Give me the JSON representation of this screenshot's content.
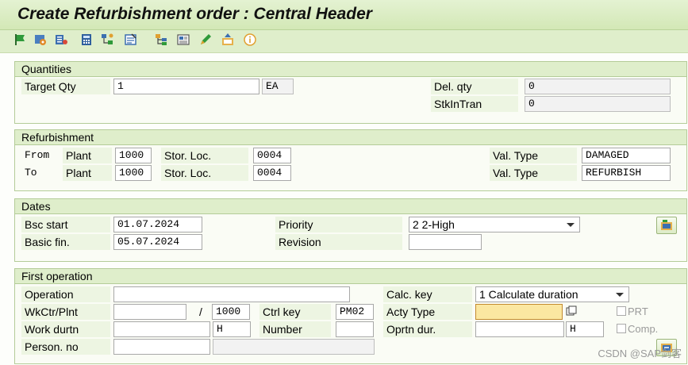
{
  "window": {
    "title": "Create Refurbishment order : Central Header"
  },
  "toolbar": {
    "icons": [
      "flag-icon",
      "settings-icon",
      "list-icon",
      "calculator-icon",
      "tree-icon",
      "task-list-icon",
      "hierarchy-icon",
      "document-icon",
      "edit-pen-icon",
      "upload-icon",
      "info-icon"
    ]
  },
  "quantities": {
    "title": "Quantities",
    "target_qty_label": "Target Qty",
    "target_qty_value": "1",
    "unit": "EA",
    "del_qty_label": "Del. qty",
    "del_qty_value": "0",
    "stk_in_tran_label": "StkInTran",
    "stk_in_tran_value": "0"
  },
  "refurbishment": {
    "title": "Refurbishment",
    "from_label": "From",
    "to_label": "To",
    "plant_label": "Plant",
    "stor_loc_label": "Stor. Loc.",
    "val_type_label": "Val. Type",
    "from_plant": "1000",
    "from_stor_loc": "0004",
    "from_val_type": "DAMAGED",
    "to_plant": "1000",
    "to_stor_loc": "0004",
    "to_val_type": "REFURBISH"
  },
  "dates": {
    "title": "Dates",
    "bsc_start_label": "Bsc start",
    "bsc_start_value": "01.07.2024",
    "basic_fin_label": "Basic fin.",
    "basic_fin_value": "05.07.2024",
    "priority_label": "Priority",
    "priority_value": "2 2-High",
    "revision_label": "Revision",
    "revision_value": ""
  },
  "first_operation": {
    "title": "First operation",
    "operation_label": "Operation",
    "operation_value": "",
    "wkctr_label": "WkCtr/Plnt",
    "wkctr_value": "",
    "separator": "/",
    "plant_value": "1000",
    "ctrl_key_label": "Ctrl key",
    "ctrl_key_value": "PM02",
    "work_durtn_label": "Work durtn",
    "work_durtn_value": "",
    "work_unit": "H",
    "number_label": "Number",
    "number_value": "",
    "person_no_label": "Person. no",
    "person_no_value": "",
    "person_name_value": "",
    "calc_key_label": "Calc. key",
    "calc_key_value": "1 Calculate duration",
    "acty_type_label": "Acty Type",
    "acty_type_value": "",
    "oprtn_dur_label": "Oprtn dur.",
    "oprtn_dur_value": "",
    "oprtn_unit": "H",
    "prt_label": "PRT",
    "comp_label": "Comp."
  },
  "watermark": "CSDN @SAP剑客"
}
